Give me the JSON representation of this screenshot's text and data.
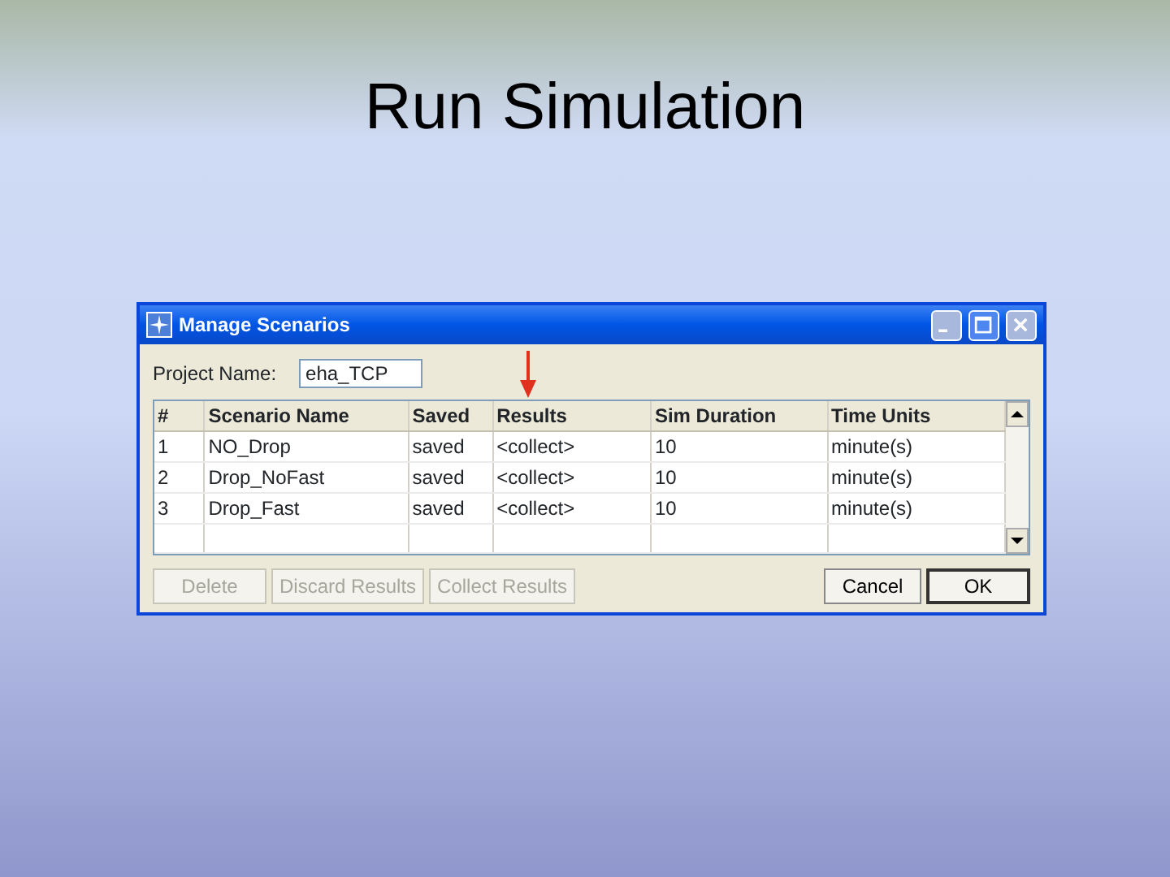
{
  "slide": {
    "title": "Run Simulation"
  },
  "window": {
    "title": "Manage Scenarios"
  },
  "project": {
    "label": "Project Name:",
    "value": "eha_TCP"
  },
  "table": {
    "columns": [
      "#",
      "Scenario Name",
      "Saved",
      "Results",
      "Sim Duration",
      "Time Units"
    ],
    "rows": [
      [
        "1",
        "NO_Drop",
        "saved",
        "<collect>",
        "10",
        "minute(s)"
      ],
      [
        "2",
        "Drop_NoFast",
        "saved",
        "<collect>",
        "10",
        "minute(s)"
      ],
      [
        "3",
        "Drop_Fast",
        "saved",
        "<collect>",
        "10",
        "minute(s)"
      ]
    ]
  },
  "buttons": [
    {
      "label": "Delete",
      "disabled": true,
      "default": false
    },
    {
      "label": "Discard Results",
      "disabled": true,
      "default": false
    },
    {
      "label": "Collect Results",
      "disabled": true,
      "default": false
    },
    {
      "label": "Cancel",
      "disabled": false,
      "default": false
    },
    {
      "label": "OK",
      "disabled": false,
      "default": true
    }
  ]
}
